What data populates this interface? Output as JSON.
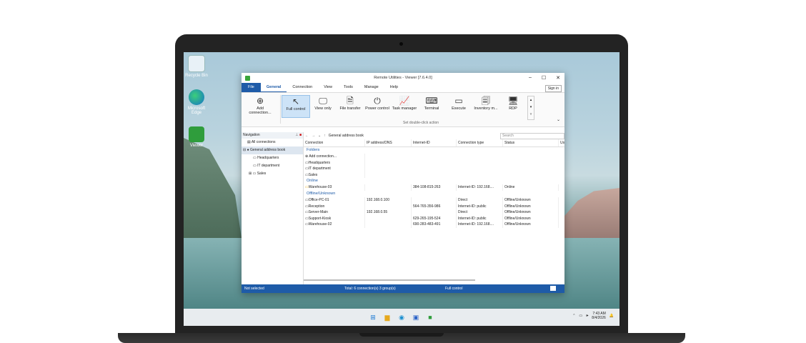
{
  "desktop": {
    "icons": [
      {
        "label": "Recycle Bin",
        "icon": "recycle-bin-icon"
      },
      {
        "label": "Microsoft Edge",
        "icon": "edge-icon"
      },
      {
        "label": "Viewer",
        "icon": "viewer-icon"
      }
    ]
  },
  "window": {
    "title": "Remote Utilities - Viewer [7.6.4.0]",
    "controls": {
      "minimize": "–",
      "maximize": "☐",
      "close": "✕"
    }
  },
  "menu": {
    "items": [
      "File",
      "General",
      "Connection",
      "View",
      "Tools",
      "Manage",
      "Help"
    ],
    "active": "General",
    "signin": "Sign in"
  },
  "ribbon": {
    "add_label": "Add connection...",
    "buttons": [
      {
        "label": "Full control",
        "icon": "cursor-icon",
        "glyph": "↖",
        "selected": true
      },
      {
        "label": "View only",
        "icon": "monitor-icon",
        "glyph": "🖵"
      },
      {
        "label": "File transfer",
        "icon": "file-transfer-icon",
        "glyph": "🗎"
      },
      {
        "label": "Power control",
        "icon": "power-icon",
        "glyph": "⏻"
      },
      {
        "label": "Task manager",
        "icon": "task-manager-icon",
        "glyph": "📈"
      },
      {
        "label": "Terminal",
        "icon": "terminal-icon",
        "glyph": "⌨"
      },
      {
        "label": "Execute",
        "icon": "execute-icon",
        "glyph": "▭"
      },
      {
        "label": "Inventory m...",
        "icon": "inventory-icon",
        "glyph": "🗐"
      },
      {
        "label": "RDP",
        "icon": "rdp-icon",
        "glyph": "🖥"
      }
    ],
    "caption": "Set double-click action"
  },
  "navigation": {
    "title": "Navigation",
    "items": [
      {
        "label": "All connections",
        "level": 1
      },
      {
        "label": "General address book",
        "level": 0,
        "selected": true
      },
      {
        "label": "Headquarters",
        "level": 1
      },
      {
        "label": "IT department",
        "level": 1
      },
      {
        "label": "Sales",
        "level": 1
      }
    ]
  },
  "address": {
    "path": "General address book",
    "search_placeholder": "Search"
  },
  "grid": {
    "columns": [
      "Connection",
      "IP address/DNS",
      "Internet-ID",
      "Connection type",
      "Status",
      "Us"
    ],
    "folders_label": "Folders",
    "folders": [
      "Add connection...",
      "Headquarters",
      "IT department",
      "Sales"
    ],
    "online_label": "Online",
    "online": [
      [
        "Warehouse-03",
        "",
        "384-108-815-263",
        "Internet-ID: 192.168....",
        "Online"
      ]
    ],
    "offline_label": "Offline/Unknown",
    "offline": [
      [
        "Office-PC-01",
        "192.168.0.100",
        "",
        "Direct",
        "Offline/Unknown"
      ],
      [
        "Reception",
        "",
        "564-765-356-986",
        "Internet-ID: public",
        "Offline/Unknown"
      ],
      [
        "Server-Main",
        "192.168.0.55",
        "",
        "Direct",
        "Offline/Unknown"
      ],
      [
        "Support-Kiosk",
        "",
        "629-265-195-524",
        "Internet-ID: public",
        "Offline/Unknown"
      ],
      [
        "Warehouse-02",
        "",
        "690-283-483-491",
        "Internet-ID: 192.168....",
        "Offline/Unknown"
      ]
    ]
  },
  "status": {
    "left": "Not selected",
    "middle": "Total: 6 connection(s) 3 group(s)",
    "right": "Full control"
  },
  "taskbar": {
    "icons": [
      "windows-start-icon",
      "file-explorer-icon",
      "edge-icon",
      "store-icon",
      "viewer-icon"
    ],
    "time": "7:43 AM",
    "date": "8/4/2026"
  }
}
